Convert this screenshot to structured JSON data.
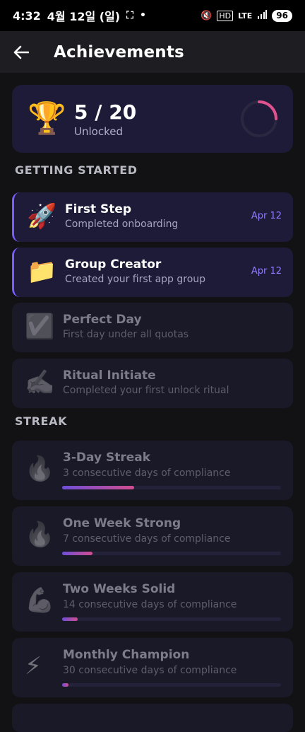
{
  "status_bar": {
    "time": "4:32",
    "date": "4월 12일 (일)",
    "network": "LTE",
    "battery": "96"
  },
  "app_bar": {
    "title": "Achievements",
    "back_icon": "arrow-left-icon"
  },
  "summary": {
    "icon": "🏆",
    "count": "5 / 20",
    "label": "Unlocked",
    "progress_fraction": 0.25,
    "ring_color": "#e0528e",
    "ring_track_color": "#2a2740"
  },
  "sections": [
    {
      "title": "GETTING STARTED",
      "items": [
        {
          "icon": "🚀",
          "title": "First Step",
          "desc": "Completed onboarding",
          "date": "Apr 12",
          "unlocked": true
        },
        {
          "icon": "📁",
          "title": "Group Creator",
          "desc": "Created your first app group",
          "date": "Apr 12",
          "unlocked": true
        },
        {
          "icon": "☑️",
          "title": "Perfect Day",
          "desc": "First day under all quotas",
          "unlocked": false
        },
        {
          "icon": "✍️",
          "title": "Ritual Initiate",
          "desc": "Completed your first unlock ritual",
          "unlocked": false
        }
      ]
    },
    {
      "title": "STREAK",
      "items": [
        {
          "icon": "🔥",
          "title": "3-Day Streak",
          "desc": "3 consecutive days of compliance",
          "unlocked": false,
          "progress": 0.33
        },
        {
          "icon": "🔥",
          "title": "One Week Strong",
          "desc": "7 consecutive days of compliance",
          "unlocked": false,
          "progress": 0.14
        },
        {
          "icon": "💪",
          "title": "Two Weeks Solid",
          "desc": "14 consecutive days of compliance",
          "unlocked": false,
          "progress": 0.07
        },
        {
          "icon": "⚡",
          "title": "Monthly Champion",
          "desc": "30 consecutive days of compliance",
          "unlocked": false,
          "progress": 0.03
        }
      ]
    }
  ],
  "colors": {
    "accent": "#7a5cff",
    "date": "#8f7cff",
    "progress_start": "#6e4fd8",
    "progress_end": "#d14d8e"
  }
}
